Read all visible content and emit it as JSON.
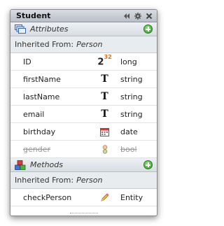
{
  "window": {
    "title": "Student"
  },
  "titlebar_icons": [
    "collapse-icon",
    "gear-icon",
    "close-icon"
  ],
  "attributes": {
    "header": "Attributes",
    "inherited_label": "Inherited From:",
    "inherited_parent": "Person",
    "rows": [
      {
        "name": "ID",
        "icon": "long-type-icon",
        "type": "long",
        "disabled": false
      },
      {
        "name": "firstName",
        "icon": "string-type-icon",
        "type": "string",
        "disabled": false
      },
      {
        "name": "lastName",
        "icon": "string-type-icon",
        "type": "string",
        "disabled": false
      },
      {
        "name": "email",
        "icon": "string-type-icon",
        "type": "string",
        "disabled": false
      },
      {
        "name": "birthday",
        "icon": "date-type-icon",
        "type": "date",
        "disabled": false
      },
      {
        "name": "gender",
        "icon": "bool-type-icon",
        "type": "bool",
        "disabled": true
      }
    ]
  },
  "methods": {
    "header": "Methods",
    "inherited_label": "Inherited From:",
    "inherited_parent": "Person",
    "rows": [
      {
        "name": "checkPerson",
        "icon": "pencil-icon",
        "type": "Entity"
      }
    ]
  },
  "long_glyph": {
    "base": "2",
    "sup": "32"
  },
  "string_glyph": "T",
  "colors": {
    "add_green": "#2d9a1f",
    "titlebar": "#c9ced5",
    "exponent_orange": "#e06a14"
  }
}
